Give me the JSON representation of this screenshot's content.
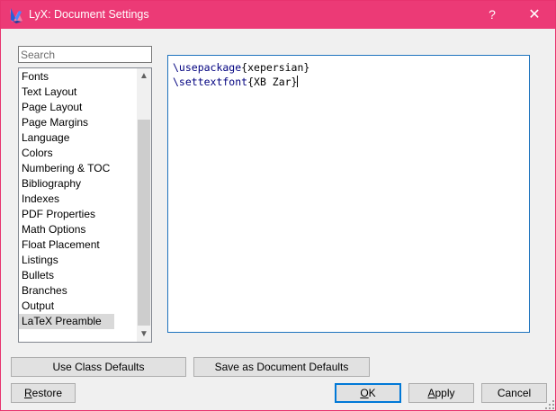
{
  "window": {
    "title": "LyX: Document Settings",
    "help_label": "?",
    "close_label": "✕"
  },
  "search": {
    "placeholder": "Search",
    "value": ""
  },
  "nav": {
    "items": [
      {
        "label": "Fonts"
      },
      {
        "label": "Text Layout"
      },
      {
        "label": "Page Layout"
      },
      {
        "label": "Page Margins"
      },
      {
        "label": "Language"
      },
      {
        "label": "Colors"
      },
      {
        "label": "Numbering & TOC"
      },
      {
        "label": "Bibliography"
      },
      {
        "label": "Indexes"
      },
      {
        "label": "PDF Properties"
      },
      {
        "label": "Math Options"
      },
      {
        "label": "Float Placement"
      },
      {
        "label": "Listings"
      },
      {
        "label": "Bullets"
      },
      {
        "label": "Branches"
      },
      {
        "label": "Output"
      },
      {
        "label": "LaTeX Preamble"
      }
    ],
    "selected": "LaTeX Preamble"
  },
  "preamble": {
    "line1_cmd": "\\usepackage",
    "line1_arg": "{xepersian}",
    "line2_cmd": "\\settextfont",
    "line2_arg": "{XB Zar}"
  },
  "buttons": {
    "use_class_defaults": "Use Class Defaults",
    "save_as_document_defaults": "Save as Document Defaults",
    "restore_accel": "R",
    "restore_rest": "estore",
    "ok_accel": "O",
    "ok_rest": "K",
    "apply_accel": "A",
    "apply_rest": "pply",
    "cancel": "Cancel"
  },
  "colors": {
    "titlebar": "#ec3a76",
    "accent": "#0078d7",
    "selection": "#d9d9d9"
  }
}
